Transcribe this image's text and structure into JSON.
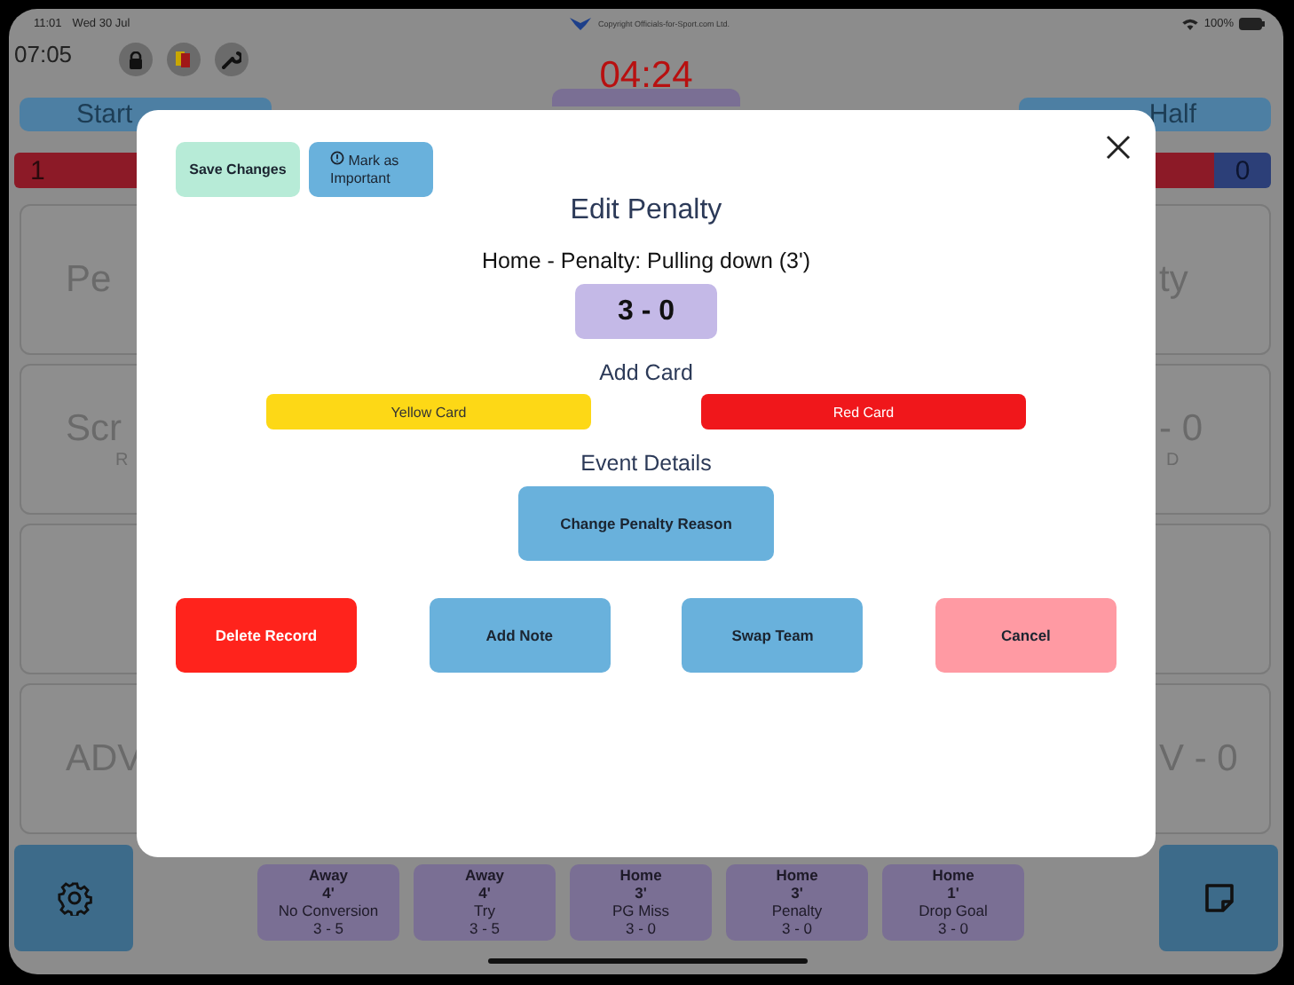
{
  "status_bar": {
    "time": "11:01",
    "date": "Wed 30 Jul",
    "copyright": "Copyright Officials-for-Sport.com Ltd.",
    "battery": "100%"
  },
  "header": {
    "elapsed": "07:05",
    "clock": "04:24"
  },
  "top_buttons": [
    {
      "label": "Start"
    },
    {
      "label": "Half"
    }
  ],
  "score_bar": {
    "home": "1",
    "away": "0"
  },
  "tiles": [
    {
      "left": {
        "label": "Pe"
      },
      "right": {
        "label": "ty"
      }
    },
    {
      "left": {
        "label": "Scr",
        "sublabel": "R"
      },
      "right": {
        "label": "- 0",
        "sublabel": "D"
      }
    },
    {
      "left": {
        "label": "ADV"
      },
      "right": {
        "label": "V - 0"
      }
    }
  ],
  "event_cards": [
    {
      "team": "Away",
      "minute": "4'",
      "event": "No Conversion",
      "score": "3 - 5"
    },
    {
      "team": "Away",
      "minute": "4'",
      "event": "Try",
      "score": "3 - 5"
    },
    {
      "team": "Home",
      "minute": "3'",
      "event": "PG Miss",
      "score": "3 - 0"
    },
    {
      "team": "Home",
      "minute": "3'",
      "event": "Penalty",
      "score": "3 - 0"
    },
    {
      "team": "Home",
      "minute": "1'",
      "event": "Drop Goal",
      "score": "3 - 0"
    }
  ],
  "dialog": {
    "top_buttons": [
      {
        "kind": "save",
        "label": "Save Changes"
      },
      {
        "kind": "important",
        "label": "Mark as Important"
      }
    ],
    "title": "Edit Penalty",
    "subtitle": "Home - Penalty: Pulling down (3')",
    "score": "3 - 0",
    "card_heading": "Add Card",
    "card_buttons": [
      {
        "kind": "yellow",
        "label": "Yellow Card"
      },
      {
        "kind": "red",
        "label": "Red Card"
      }
    ],
    "details_heading": "Event Details",
    "details_button": "Change Penalty Reason",
    "actions": [
      {
        "kind": "delete",
        "label": "Delete Record"
      },
      {
        "kind": "primary",
        "label": "Add Note"
      },
      {
        "kind": "primary",
        "label": "Swap Team"
      },
      {
        "kind": "cancel",
        "label": "Cancel"
      }
    ]
  }
}
